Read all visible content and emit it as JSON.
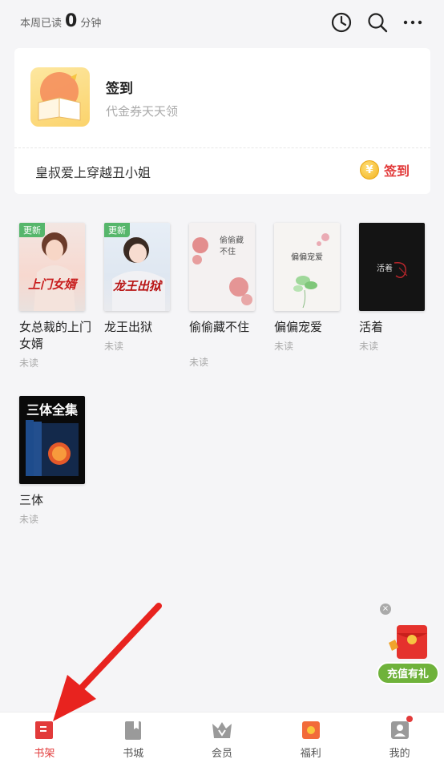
{
  "header": {
    "weekly_prefix": "本周已读",
    "weekly_minutes": "0",
    "weekly_unit": "分钟",
    "icons": [
      "history-icon",
      "search-icon",
      "more-icon"
    ]
  },
  "signin_card": {
    "title": "签到",
    "subtitle": "代金券天天领",
    "book_title": "皇叔爱上穿越丑小姐",
    "coin_symbol": "¥",
    "sign_label": "签到"
  },
  "books": [
    {
      "title": "女总裁的上门女婿",
      "status": "未读",
      "badge": "更新",
      "cover_text": "上门女婿"
    },
    {
      "title": "龙王出狱",
      "status": "未读",
      "badge": "更新",
      "cover_text": "龙王出狱"
    },
    {
      "title": "偷偷藏不住",
      "status": "未读",
      "badge": "",
      "cover_text": "偷偷藏不住"
    },
    {
      "title": "偏偏宠爱",
      "status": "未读",
      "badge": "",
      "cover_text": "偏偏宠爱"
    },
    {
      "title": "活着",
      "status": "未读",
      "badge": "",
      "cover_text": "活着"
    },
    {
      "title": "三体",
      "status": "未读",
      "badge": "",
      "cover_text": "三体全集"
    }
  ],
  "floating": {
    "close": "×",
    "recharge_label": "充值有礼"
  },
  "bottom_nav": [
    {
      "label": "书架",
      "icon": "bookshelf-icon",
      "active": true
    },
    {
      "label": "书城",
      "icon": "bookstore-icon",
      "active": false
    },
    {
      "label": "会员",
      "icon": "vip-icon",
      "active": false
    },
    {
      "label": "福利",
      "icon": "gift-icon",
      "active": false
    },
    {
      "label": "我的",
      "icon": "profile-icon",
      "active": false
    }
  ],
  "colors": {
    "accent": "#e23a3a",
    "badge": "#56b66b",
    "recharge": "#6fb23b"
  }
}
